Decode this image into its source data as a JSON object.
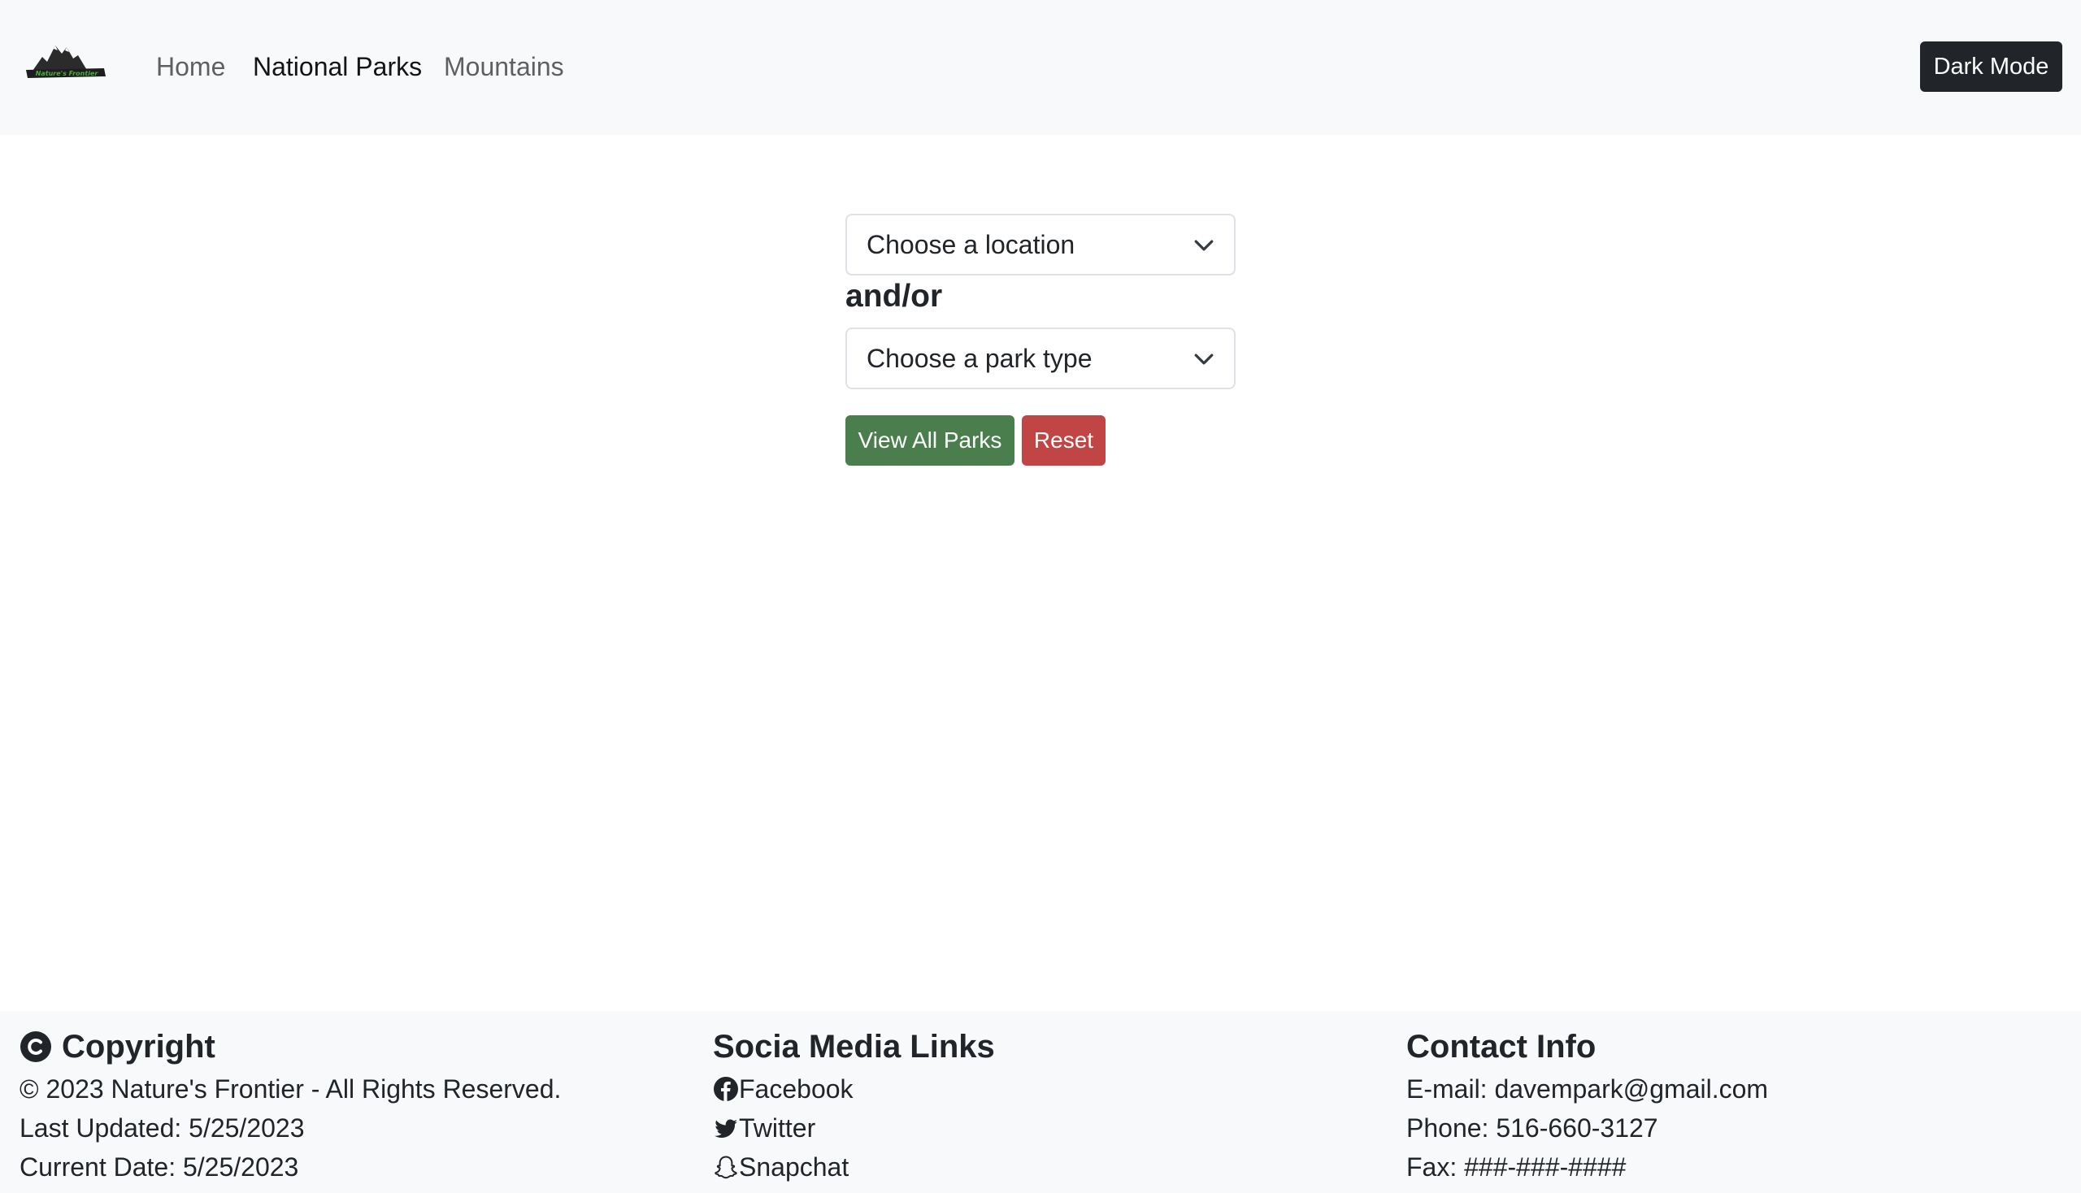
{
  "nav": {
    "logo_text": "Nature's Frontier",
    "links": [
      {
        "label": "Home",
        "active": false
      },
      {
        "label": "National Parks",
        "active": true
      },
      {
        "label": "Mountains",
        "active": false
      }
    ],
    "dark_mode_label": "Dark Mode"
  },
  "filters": {
    "location_selected": "Choose a location",
    "separator": "and/or",
    "park_type_selected": "Choose a park type",
    "view_all_label": "View All Parks",
    "reset_label": "Reset"
  },
  "footer": {
    "copyright": {
      "heading": "Copyright",
      "lines": [
        "© 2023 Nature's Frontier - All Rights Reserved.",
        "Last Updated: 5/25/2023",
        "Current Date: 5/25/2023"
      ]
    },
    "social": {
      "heading": "Socia Media Links",
      "links": [
        {
          "label": "Facebook",
          "icon": "facebook-icon"
        },
        {
          "label": "Twitter",
          "icon": "twitter-icon"
        },
        {
          "label": "Snapchat",
          "icon": "snapchat-icon"
        }
      ]
    },
    "contact": {
      "heading": "Contact Info",
      "lines": [
        "E-mail: davempark@gmail.com",
        "Phone: 516-660-3127",
        "Fax: ###-###-####"
      ]
    }
  },
  "colors": {
    "navbar_bg": "#f8f9fa",
    "dark_button": "#212529",
    "success_button": "#4a7f4d",
    "danger_button": "#c14545",
    "logo_green": "#4caf3a"
  }
}
